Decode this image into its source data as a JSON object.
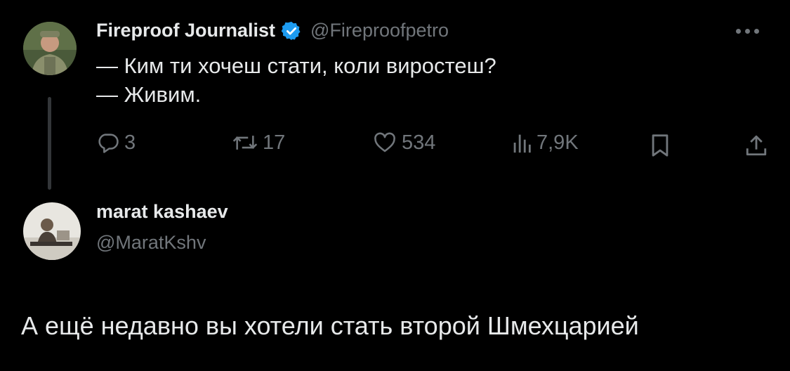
{
  "tweet": {
    "author_name": "Fireproof Journalist",
    "author_handle": "@Fireproofpetro",
    "verified_color": "#1d9bf0",
    "text": "— Ким ти хочеш стати, коли виростеш?\n— Живим.",
    "actions": {
      "replies": "3",
      "retweets": "17",
      "likes": "534",
      "views": "7,9K"
    },
    "icons": [
      "reply-icon",
      "retweet-icon",
      "like-icon",
      "views-icon",
      "bookmark-icon",
      "share-icon",
      "more-icon"
    ]
  },
  "reply": {
    "author_name": "marat kashaev",
    "author_handle": "@MaratKshv",
    "text": "А ещё недавно вы хотели стать второй Шмехцарией"
  }
}
